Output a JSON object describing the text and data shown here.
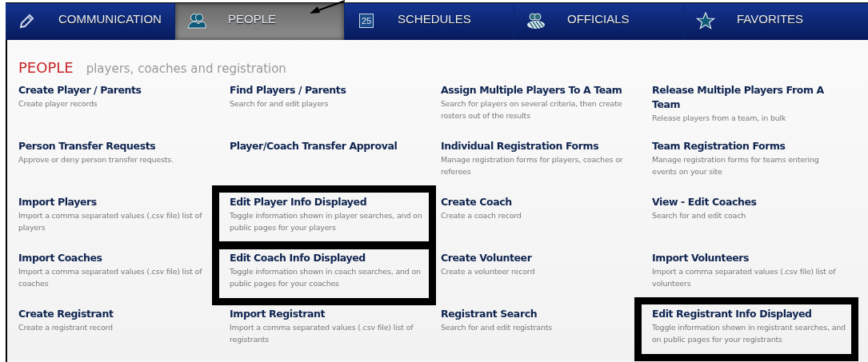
{
  "nav": {
    "tabs": [
      {
        "label": "COMMUNICATION",
        "kind": "pencil",
        "selected": false
      },
      {
        "label": "PEOPLE",
        "kind": "people",
        "selected": true
      },
      {
        "label": "SCHEDULES",
        "kind": "calendar",
        "icon_text": "25",
        "selected": false
      },
      {
        "label": "OFFICIALS",
        "kind": "officials",
        "selected": false
      },
      {
        "label": "FAVORITES",
        "kind": "star",
        "selected": false
      }
    ]
  },
  "annotation": {
    "kind": "arrow"
  },
  "heading": {
    "title": "PEOPLE",
    "subtitle": "players, coaches and registration"
  },
  "items": [
    {
      "title": "Create Player / Parents",
      "description": "Create player records",
      "highlighted": false
    },
    {
      "title": "Find Players / Parents",
      "description": "Search for and edit players",
      "highlighted": false
    },
    {
      "title": "Assign Multiple Players To A Team",
      "description": "Search for players on several criteria, then create rosters out of the results",
      "highlighted": false
    },
    {
      "title": "Release Multiple Players From A Team",
      "description": "Release players from a team, in bulk",
      "highlighted": false
    },
    {
      "title": "Person Transfer Requests",
      "description": "Approve or deny person transfer requests.",
      "highlighted": false
    },
    {
      "title": "Player/Coach Transfer Approval",
      "highlighted": false
    },
    {
      "title": "Individual Registration Forms",
      "description": "Manage registration forms for players, coaches or referees",
      "highlighted": false
    },
    {
      "title": "Team Registration Forms",
      "description": "Manage registration forms for teams entering events on your site",
      "highlighted": false
    },
    {
      "title": "Import Players",
      "description": "Import a comma separated values (.csv file) list of players",
      "highlighted": false
    },
    {
      "title": "Edit Player Info Displayed",
      "description": "Toggle information shown in player searches, and on public pages for your players",
      "highlighted": true
    },
    {
      "title": "Create Coach",
      "description": "Create a coach record",
      "highlighted": false
    },
    {
      "title": "View - Edit Coaches",
      "description": "Search for and edit coach",
      "highlighted": false
    },
    {
      "title": "Import Coaches",
      "description": "Import a comma separated values (.csv file) list of coaches",
      "highlighted": false
    },
    {
      "title": "Edit Coach Info Displayed",
      "description": "Toggle information shown in coach searches, and on public pages for your coaches",
      "highlighted": true
    },
    {
      "title": "Create Volunteer",
      "description": "Create a volunteer record",
      "highlighted": false
    },
    {
      "title": "Import Volunteers",
      "description": "Import a comma separated values (.csv file) list of volunteers",
      "highlighted": false
    },
    {
      "title": "Create Registrant",
      "description": "Create a registrant record",
      "highlighted": false
    },
    {
      "title": "Import Registrant",
      "description": "Import a comma separated values (.csv file) list of registrants",
      "highlighted": false
    },
    {
      "title": "Registrant Search",
      "description": "Search for and edit registrants",
      "highlighted": false
    },
    {
      "title": "Edit Registrant Info Displayed",
      "description": "Toggle information shown in registrant searches, and on public pages for your registrants",
      "highlighted": true
    }
  ]
}
